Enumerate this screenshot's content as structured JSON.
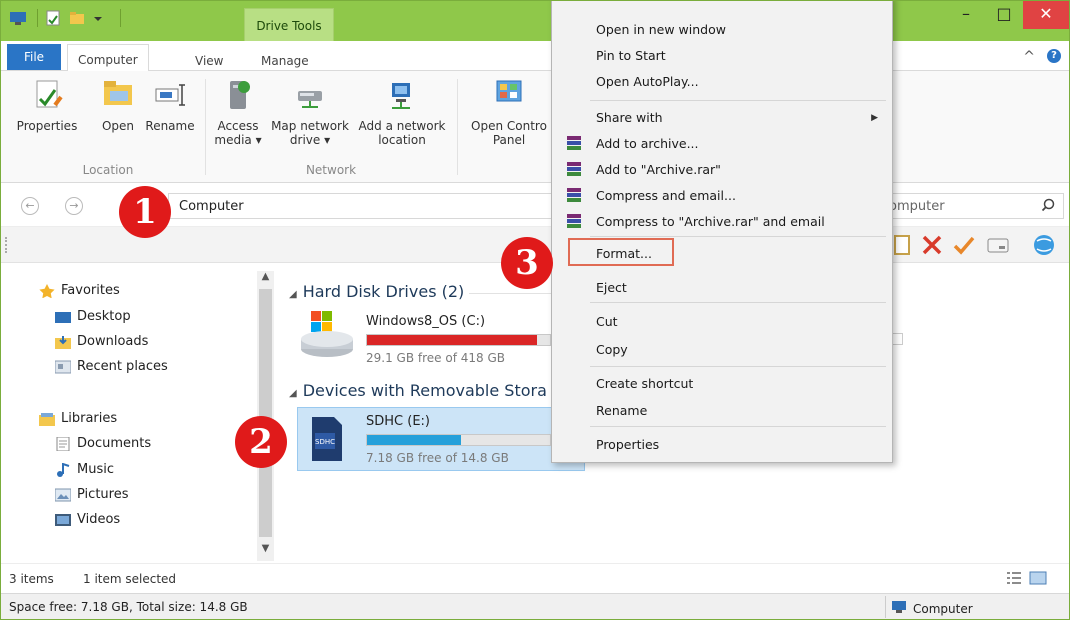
{
  "window": {
    "context_tab": "Drive Tools",
    "buttons": {
      "minimize": "–",
      "maximize": "□",
      "close": "✕"
    }
  },
  "ribbon_tabs": {
    "file": "File",
    "computer": "Computer",
    "view": "View",
    "manage": "Manage",
    "collapse_glyph": "^"
  },
  "ribbon": {
    "location": {
      "label": "Location",
      "properties": "Properties",
      "open": "Open",
      "rename": "Rename"
    },
    "network": {
      "label": "Network",
      "access_media_1": "Access",
      "access_media_2": "media ▾",
      "map_drive_1": "Map network",
      "map_drive_2": "drive ▾",
      "add_location_1": "Add a network",
      "add_location_2": "location"
    },
    "system": {
      "open_control_1": "Open Contro",
      "open_control_2": "Panel"
    }
  },
  "address": {
    "path": "Computer",
    "search_text": "omputer",
    "back_glyph": "←",
    "forward_glyph": "→"
  },
  "nav": {
    "favorites": "Favorites",
    "desktop": "Desktop",
    "downloads": "Downloads",
    "recent": "Recent places",
    "libraries": "Libraries",
    "documents": "Documents",
    "music": "Music",
    "pictures": "Pictures",
    "videos": "Videos"
  },
  "content": {
    "hdd_header": "Hard Disk Drives (2)",
    "removable_header": "Devices with Removable Stora",
    "drives": [
      {
        "name": "Windows8_OS (C:)",
        "free": "29.1 GB free of 418 GB",
        "used_fraction": 0.93,
        "bar_color": "#da2626"
      },
      {
        "name": "SDHC (E:)",
        "free": "7.18 GB free of 14.8 GB",
        "used_fraction": 0.515,
        "bar_color": "#26a0da"
      }
    ]
  },
  "status": {
    "items": "3 items",
    "selected": "1 item selected"
  },
  "details": {
    "space": "Space free: 7.18 GB, Total size: 14.8 GB",
    "location": "Computer"
  },
  "context_menu": {
    "open_new_window": "Open in new window",
    "pin_start": "Pin to Start",
    "open_autoplay": "Open AutoPlay...",
    "share_with": "Share with",
    "add_archive": "Add to archive...",
    "add_archive_rar": "Add to \"Archive.rar\"",
    "compress_email": "Compress and email...",
    "compress_rar_email": "Compress to \"Archive.rar\" and email",
    "format": "Format...",
    "eject": "Eject",
    "cut": "Cut",
    "copy": "Copy",
    "create_shortcut": "Create shortcut",
    "rename": "Rename",
    "properties": "Properties",
    "submenu_arrow": "▶"
  },
  "markers": {
    "one": "1",
    "two": "2",
    "three": "3"
  },
  "colors": {
    "titlebar": "#8fc84a",
    "file_tab": "#2a75c6",
    "marker": "#e01a1a",
    "format_highlight": "#e06b54"
  }
}
